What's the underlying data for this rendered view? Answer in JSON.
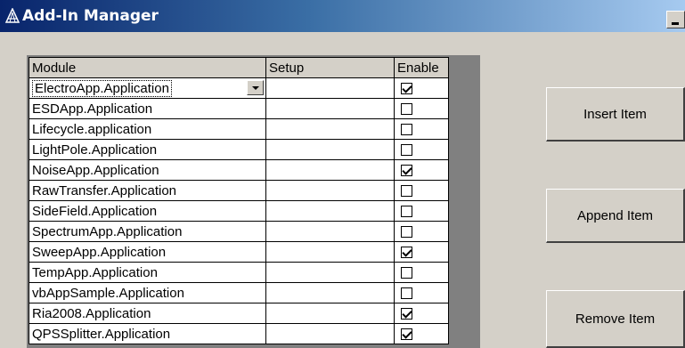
{
  "window": {
    "title": "Add-In Manager"
  },
  "grid": {
    "columns": [
      "Module",
      "Setup",
      "Enable"
    ],
    "rows": [
      {
        "module": "ElectroApp.Application",
        "setup": "",
        "enabled": true
      },
      {
        "module": "ESDApp.Application",
        "setup": "",
        "enabled": false
      },
      {
        "module": "Lifecycle.application",
        "setup": "",
        "enabled": false
      },
      {
        "module": "LightPole.Application",
        "setup": "",
        "enabled": false
      },
      {
        "module": "NoiseApp.Application",
        "setup": "",
        "enabled": true
      },
      {
        "module": "RawTransfer.Application",
        "setup": "",
        "enabled": false
      },
      {
        "module": "SideField.Application",
        "setup": "",
        "enabled": false
      },
      {
        "module": "SpectrumApp.Application",
        "setup": "",
        "enabled": false
      },
      {
        "module": "SweepApp.Application",
        "setup": "",
        "enabled": true
      },
      {
        "module": "TempApp.Application",
        "setup": "",
        "enabled": false
      },
      {
        "module": "vbAppSample.Application",
        "setup": "",
        "enabled": false
      },
      {
        "module": "Ria2008.Application",
        "setup": "",
        "enabled": true
      },
      {
        "module": "QPSSplitter.Application",
        "setup": "",
        "enabled": true
      }
    ]
  },
  "buttons": {
    "insert": "Insert Item",
    "append": "Append Item",
    "remove": "Remove Item"
  },
  "colors": {
    "title_bar_start": "#08246b",
    "title_bar_end": "#a6caf0",
    "face": "#d4d0c8"
  },
  "icons": {
    "app": "compass-triangle-icon",
    "minimize": "minimize-icon",
    "dropdown": "chevron-down-icon",
    "checkbox": "checkmark-icon"
  }
}
